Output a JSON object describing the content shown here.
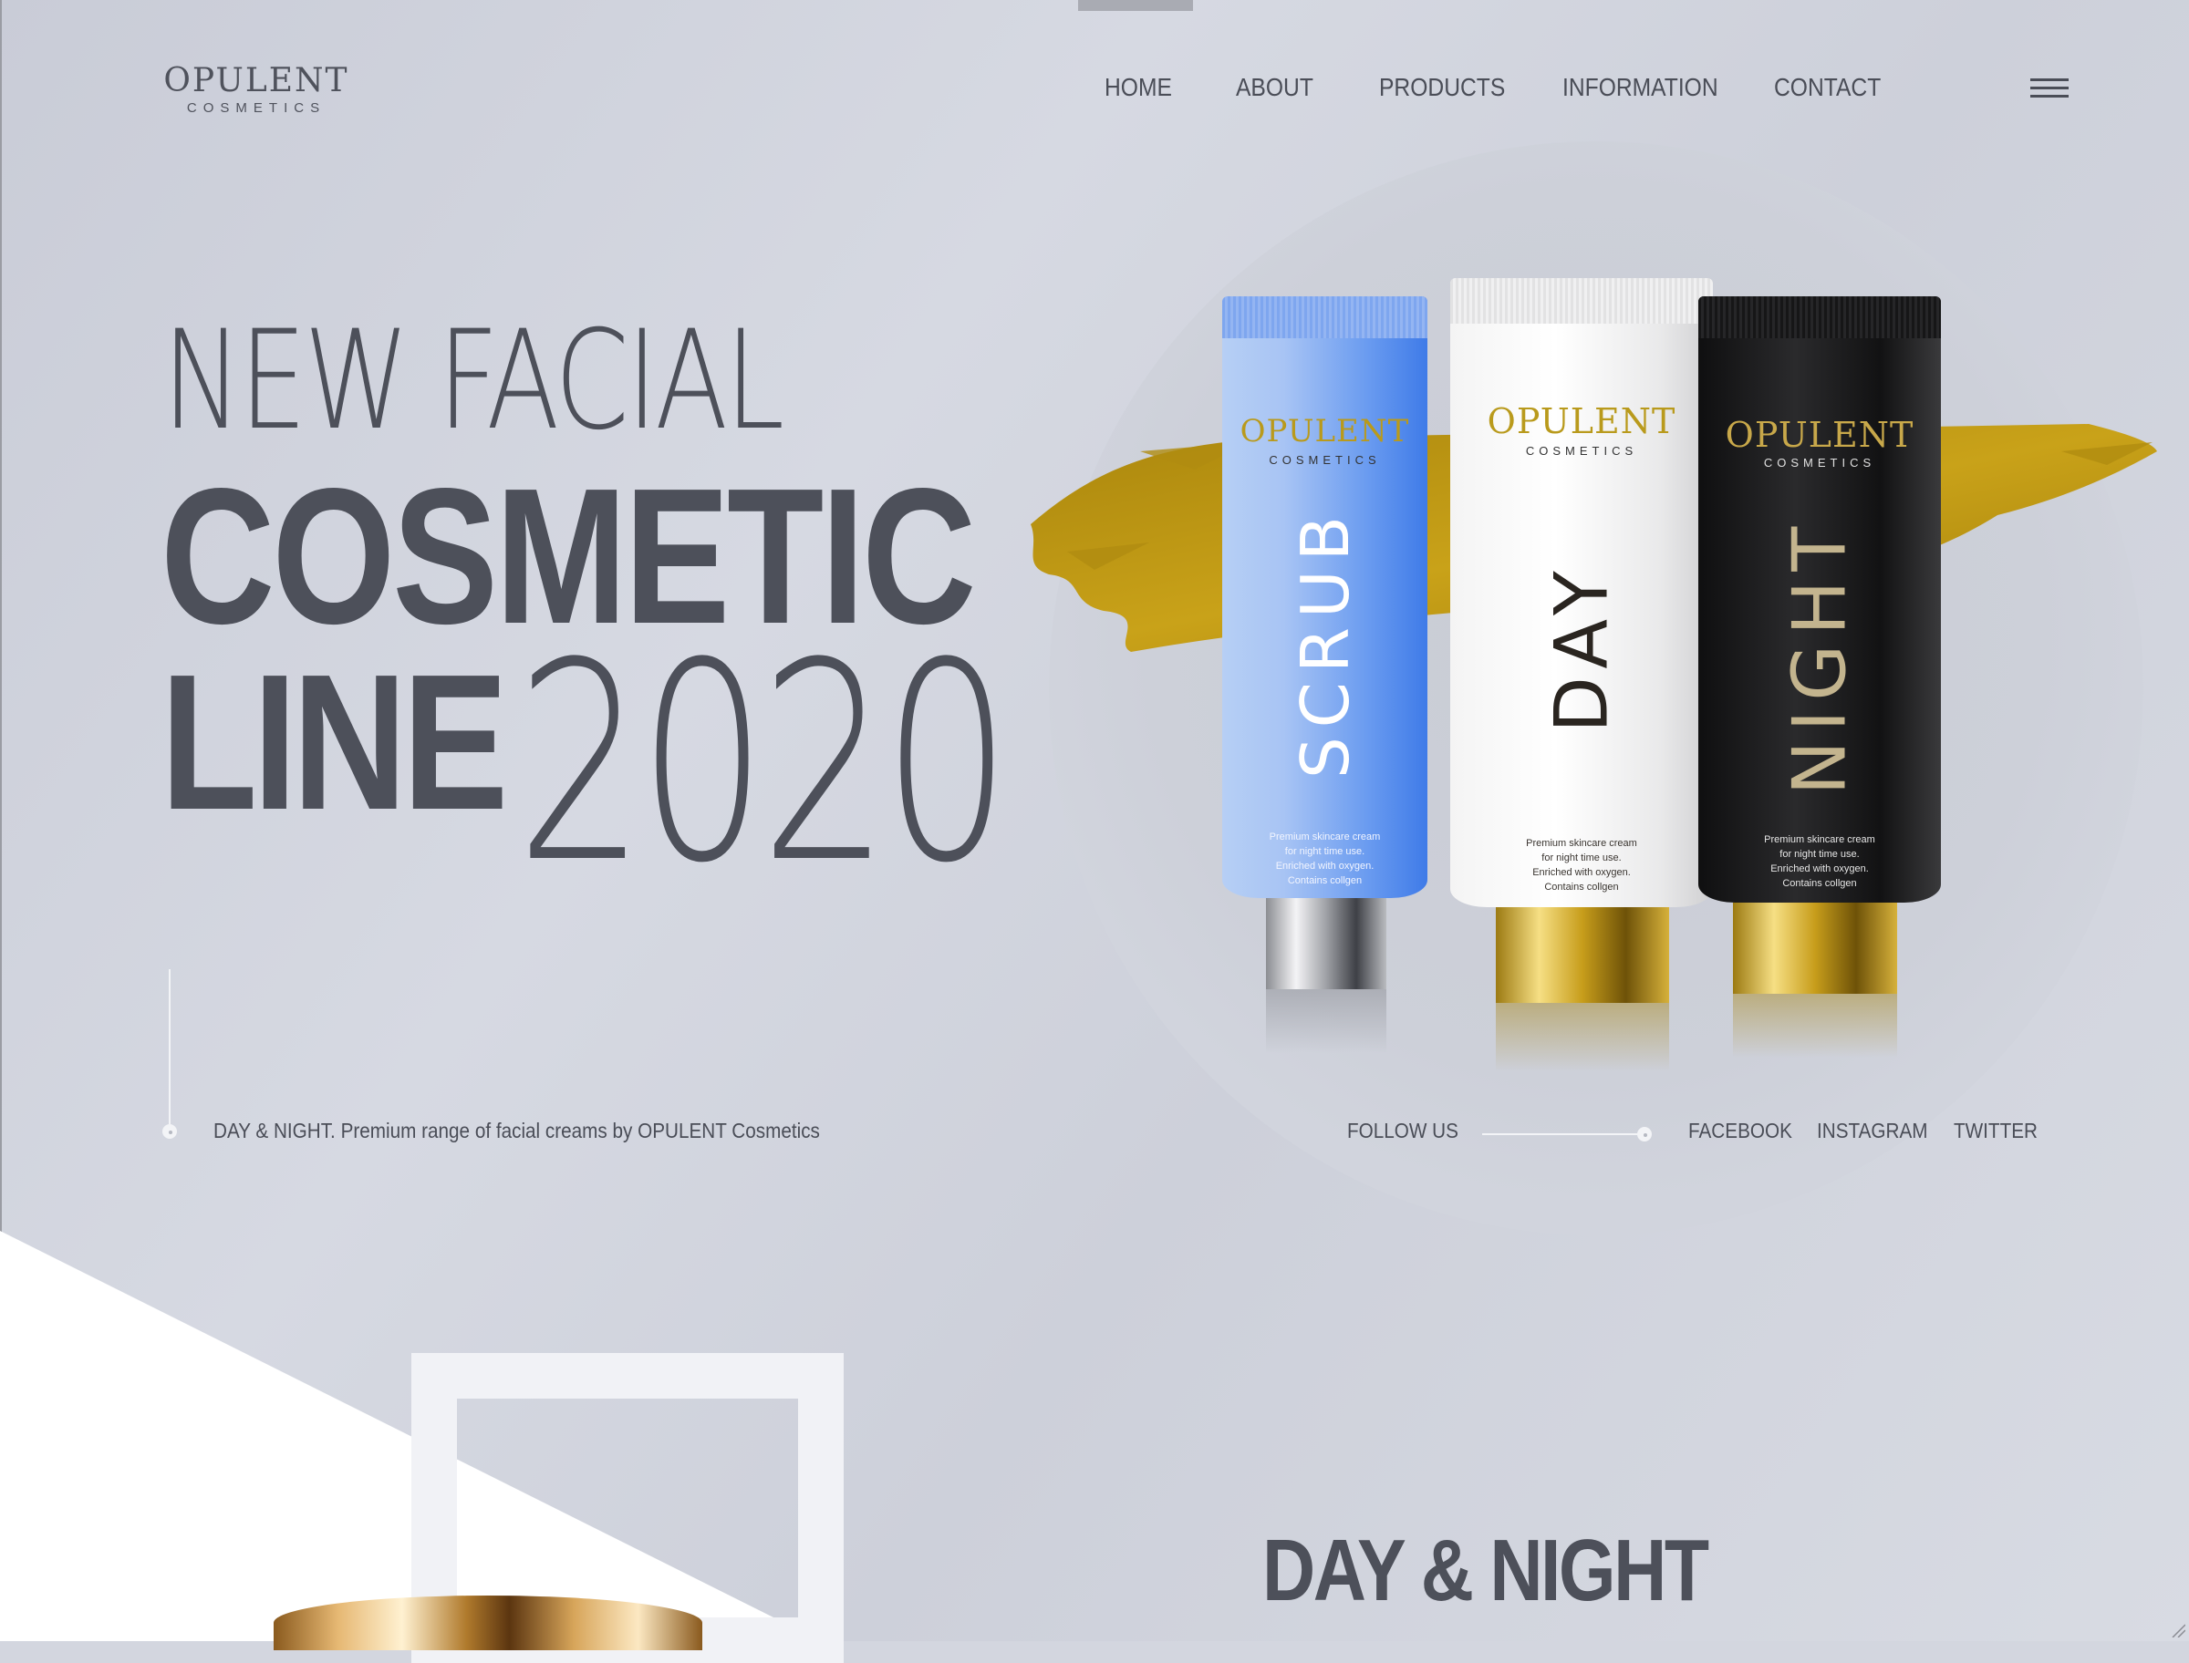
{
  "brand": {
    "name": "OPULENT",
    "sub": "COSMETICS"
  },
  "nav": {
    "items": [
      "HOME",
      "ABOUT",
      "PRODUCTS",
      "INFORMATION",
      "CONTACT"
    ],
    "menu_icon": "hamburger-menu-icon"
  },
  "hero": {
    "line1": "NEW FACIAL",
    "line2": "COSMETIC",
    "line3": "LINE",
    "year": "2020",
    "tagline": "DAY & NIGHT. Premium range of facial creams by OPULENT Cosmetics"
  },
  "social": {
    "label": "FOLLOW US",
    "links": [
      "FACEBOOK",
      "INSTAGRAM",
      "TWITTER"
    ]
  },
  "products": [
    {
      "brand": "OPULENT",
      "sub": "COSMETICS",
      "name": "SCRUB",
      "desc": [
        "Premium skincare cream",
        "for night time use.",
        "Enriched with oxygen.",
        "Contains collgen"
      ]
    },
    {
      "brand": "OPULENT",
      "sub": "COSMETICS",
      "name": "DAY",
      "desc": [
        "Premium skincare cream",
        "for night time use.",
        "Enriched with oxygen.",
        "Contains collgen"
      ]
    },
    {
      "brand": "OPULENT",
      "sub": "COSMETICS",
      "name": "NIGHT",
      "desc": [
        "Premium skincare cream",
        "for night time use.",
        "Enriched with oxygen.",
        "Contains collgen"
      ]
    }
  ],
  "section": {
    "title": "DAY & NIGHT"
  },
  "colors": {
    "background": "#d3d6df",
    "text": "#4d505a",
    "gold": "#c09a12",
    "scrub_blue": "#4f8ef2",
    "night_black": "#1a1a1a"
  }
}
